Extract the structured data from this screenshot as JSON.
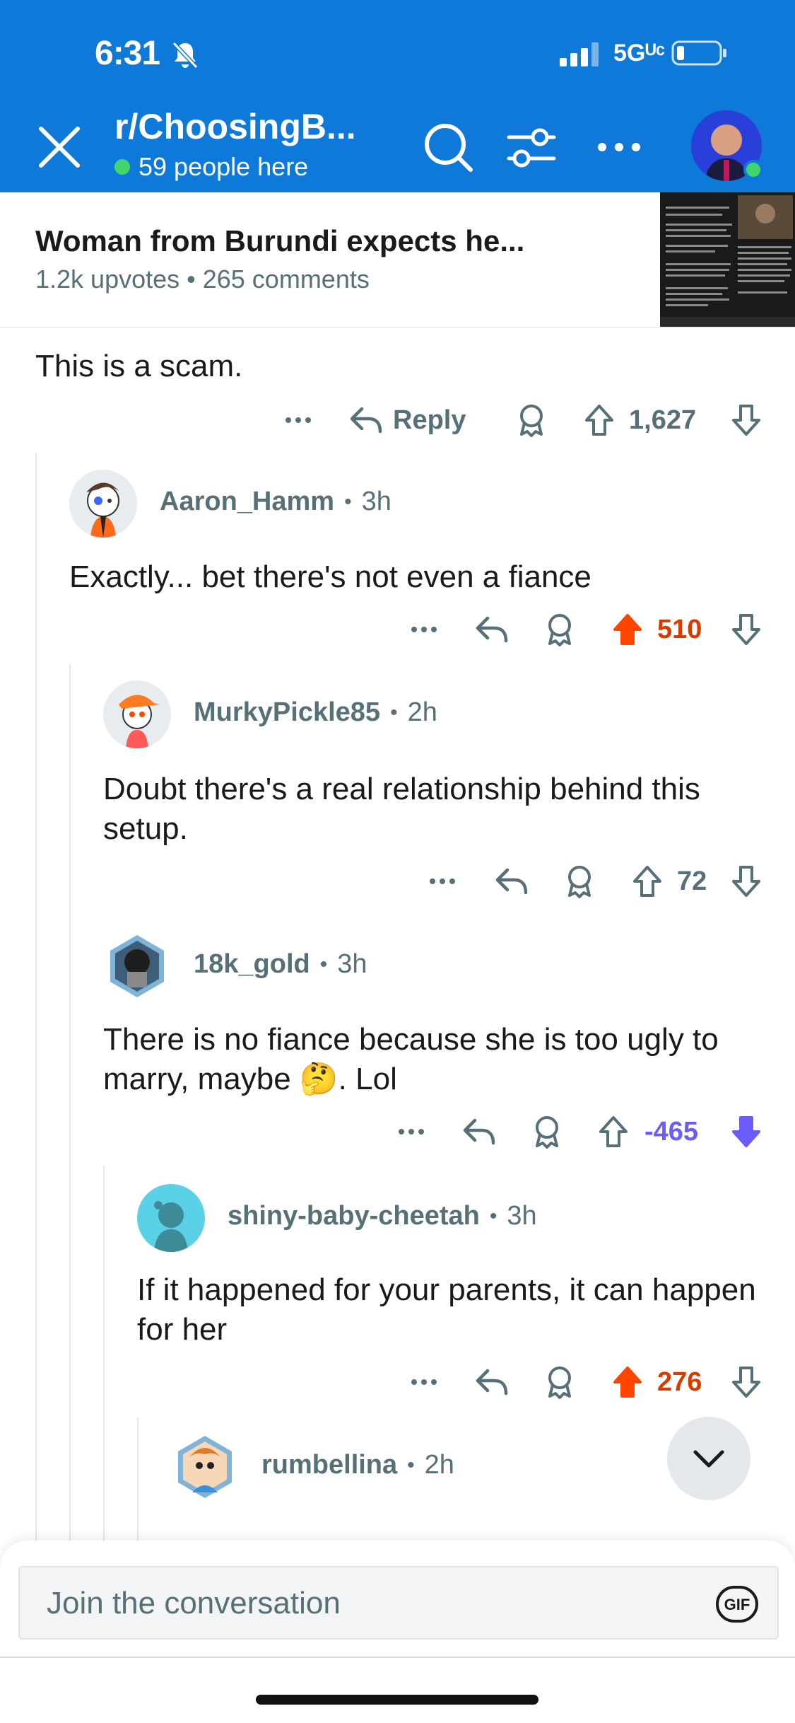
{
  "status_bar": {
    "time": "6:31",
    "network": "5Gᵁᶜ"
  },
  "header": {
    "subreddit": "r/ChoosingB...",
    "online_text": "59 people here"
  },
  "post": {
    "title": "Woman from Burundi expects he...",
    "meta": "1.2k upvotes • 265 comments"
  },
  "thread": {
    "top_comment": {
      "text": "This is a scam.",
      "reply_label": "Reply",
      "score": "1,627"
    },
    "comments": [
      {
        "author": "Aaron_Hamm",
        "age": "3h",
        "text": "Exactly... bet there's not even a fiance",
        "score": "510",
        "vote": "up"
      },
      {
        "author": "MurkyPickle85",
        "age": "2h",
        "text": "Doubt there's a real relationship behind this setup.",
        "score": "72",
        "vote": "none"
      },
      {
        "author": "18k_gold",
        "age": "3h",
        "text": "There is no fiance because she is too ugly to marry, maybe 🤔. Lol",
        "score": "-465",
        "vote": "down"
      },
      {
        "author": "shiny-baby-cheetah",
        "age": "3h",
        "text": "If it happened for your parents, it can happen for her",
        "score": "276",
        "vote": "up"
      },
      {
        "author": "rumbellina",
        "age": "2h"
      }
    ]
  },
  "composer": {
    "placeholder": "Join the conversation",
    "gif_label": "GIF"
  },
  "colors": {
    "header_bg": "#0e79d9",
    "upvote": "#d93a00",
    "downvote": "#6a5cff",
    "online": "#41d66b"
  }
}
